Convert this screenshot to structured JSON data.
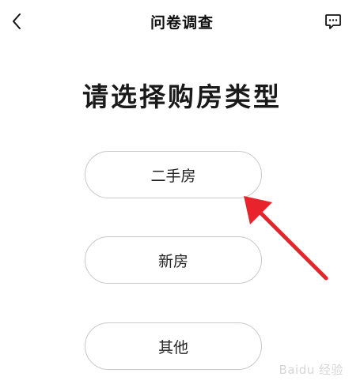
{
  "header": {
    "title": "问卷调查",
    "back_icon": "chevron-left-icon",
    "feedback_icon": "message-dots-icon"
  },
  "main": {
    "question": "请选择购房类型",
    "options": [
      {
        "label": "二手房"
      },
      {
        "label": "新房"
      },
      {
        "label": "其他"
      }
    ]
  },
  "annotation": {
    "arrow_color": "#e8232b"
  },
  "watermark": {
    "text": "Baidu 经验"
  }
}
